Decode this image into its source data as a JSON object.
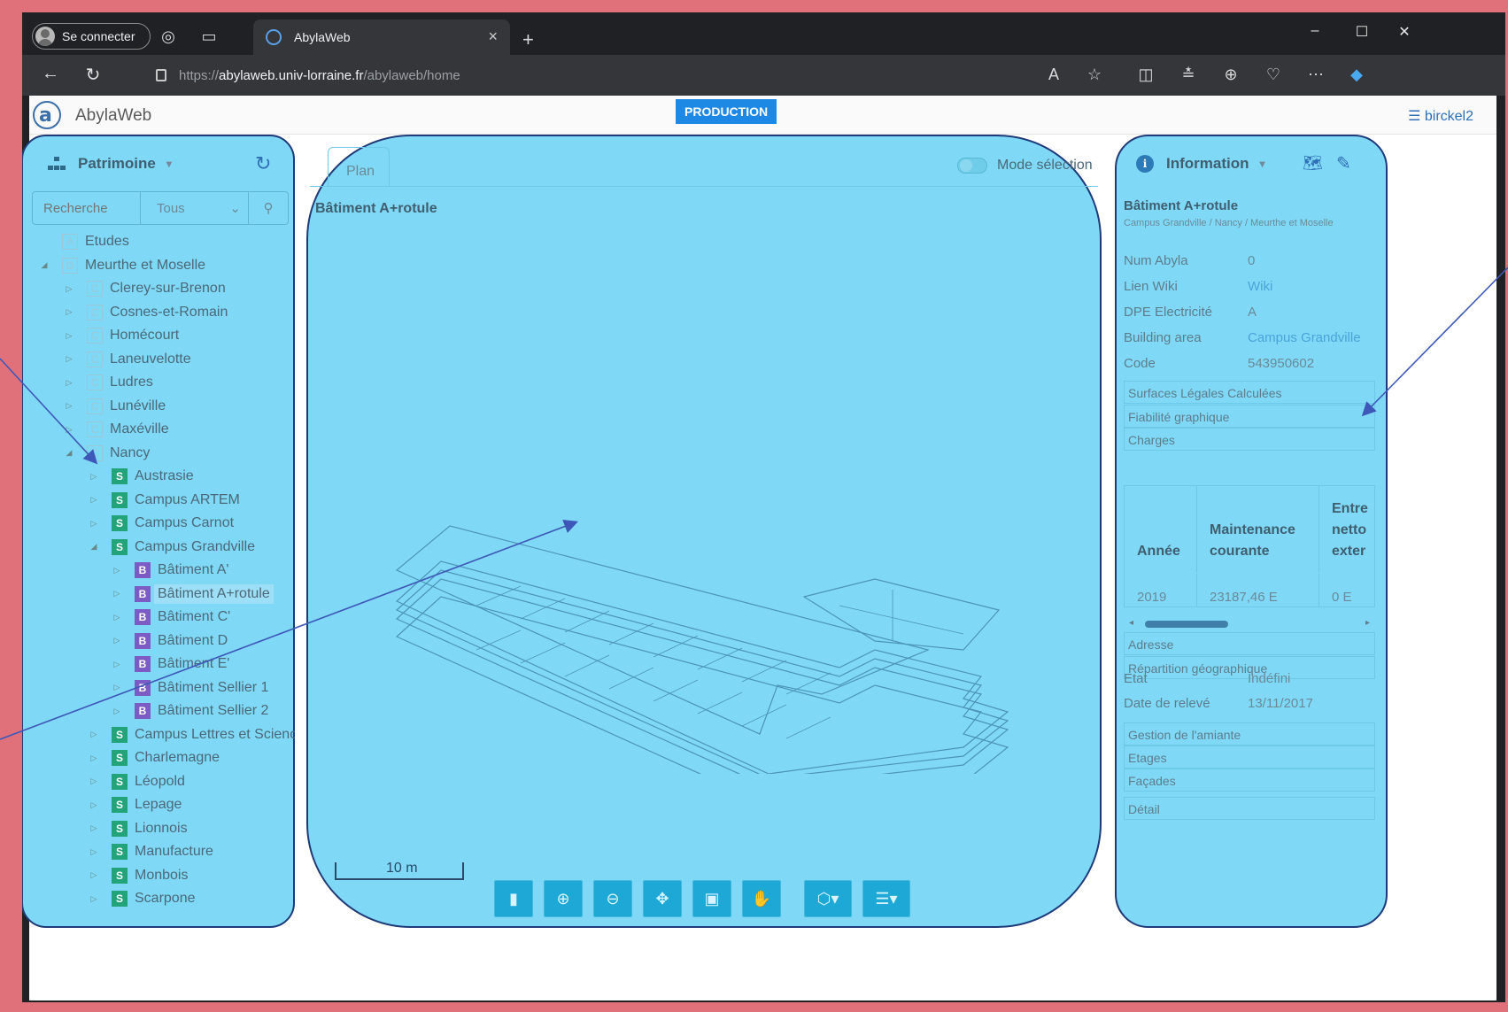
{
  "browser": {
    "profile_label": "Se connecter",
    "tab_title": "AbylaWeb",
    "url_scheme": "https://",
    "url_host": "abylaweb.univ-lorraine.fr",
    "url_path": "/abylaweb/home",
    "new_tab": "+",
    "tab_close": "×",
    "win_min": "–",
    "win_max": "☐",
    "win_close": "✕"
  },
  "app": {
    "title": "AbylaWeb",
    "env_badge": "PRODUCTION",
    "user": "☰ birckel2"
  },
  "left_panel": {
    "title": "Patrimoine",
    "search_placeholder": "Recherche",
    "filter_value": "Tous",
    "tree": [
      {
        "label": "Etudes",
        "badge": "A",
        "type": "outline",
        "level": 1,
        "expander": ""
      },
      {
        "label": "Meurthe et Moselle",
        "badge": "D",
        "type": "outline",
        "level": 1,
        "expander": "◢"
      },
      {
        "label": "Clerey-sur-Brenon",
        "badge": "C",
        "type": "outline",
        "level": 2,
        "expander": "▷"
      },
      {
        "label": "Cosnes-et-Romain",
        "badge": "C",
        "type": "outline",
        "level": 2,
        "expander": "▷"
      },
      {
        "label": "Homécourt",
        "badge": "C",
        "type": "outline",
        "level": 2,
        "expander": "▷"
      },
      {
        "label": "Laneuvelotte",
        "badge": "C",
        "type": "outline",
        "level": 2,
        "expander": "▷"
      },
      {
        "label": "Ludres",
        "badge": "C",
        "type": "outline",
        "level": 2,
        "expander": "▷"
      },
      {
        "label": "Lunéville",
        "badge": "C",
        "type": "outline",
        "level": 2,
        "expander": "▷"
      },
      {
        "label": "Maxéville",
        "badge": "C",
        "type": "outline",
        "level": 2,
        "expander": "▷"
      },
      {
        "label": "Nancy",
        "badge": "C",
        "type": "outline",
        "level": 2,
        "expander": "◢"
      },
      {
        "label": "Austrasie",
        "badge": "S",
        "type": "site",
        "level": 3,
        "expander": "▷"
      },
      {
        "label": "Campus ARTEM",
        "badge": "S",
        "type": "site",
        "level": 3,
        "expander": "▷"
      },
      {
        "label": "Campus Carnot",
        "badge": "S",
        "type": "site",
        "level": 3,
        "expander": "▷"
      },
      {
        "label": "Campus Grandville",
        "badge": "S",
        "type": "site",
        "level": 3,
        "expander": "◢"
      },
      {
        "label": "Bâtiment A'",
        "badge": "B",
        "type": "bat",
        "level": 4,
        "expander": "▷"
      },
      {
        "label": "Bâtiment A+rotule",
        "badge": "B",
        "type": "bat",
        "level": 4,
        "expander": "▷",
        "selected": true
      },
      {
        "label": "Bâtiment C'",
        "badge": "B",
        "type": "bat",
        "level": 4,
        "expander": "▷"
      },
      {
        "label": "Bâtiment D",
        "badge": "B",
        "type": "bat",
        "level": 4,
        "expander": "▷"
      },
      {
        "label": "Bâtiment E'",
        "badge": "B",
        "type": "bat",
        "level": 4,
        "expander": "▷"
      },
      {
        "label": "Bâtiment Sellier 1",
        "badge": "B",
        "type": "bat",
        "level": 4,
        "expander": "▷"
      },
      {
        "label": "Bâtiment Sellier 2",
        "badge": "B",
        "type": "bat",
        "level": 4,
        "expander": "▷"
      },
      {
        "label": "Campus Lettres et Sciences",
        "badge": "S",
        "type": "site",
        "level": 3,
        "expander": "▷"
      },
      {
        "label": "Charlemagne",
        "badge": "S",
        "type": "site",
        "level": 3,
        "expander": "▷"
      },
      {
        "label": "Léopold",
        "badge": "S",
        "type": "site",
        "level": 3,
        "expander": "▷"
      },
      {
        "label": "Lepage",
        "badge": "S",
        "type": "site",
        "level": 3,
        "expander": "▷"
      },
      {
        "label": "Lionnois",
        "badge": "S",
        "type": "site",
        "level": 3,
        "expander": "▷"
      },
      {
        "label": "Manufacture",
        "badge": "S",
        "type": "site",
        "level": 3,
        "expander": "▷"
      },
      {
        "label": "Monbois",
        "badge": "S",
        "type": "site",
        "level": 3,
        "expander": "▷"
      },
      {
        "label": "Scarpone",
        "badge": "S",
        "type": "site",
        "level": 3,
        "expander": "▷"
      }
    ]
  },
  "center": {
    "tab_label": "Plan",
    "mode_label": "Mode sélection",
    "building_title": "Bâtiment A+rotule",
    "scale_label": "10 m"
  },
  "right_panel": {
    "title": "Information",
    "building": "Bâtiment A+rotule",
    "path": "Campus Grandville / Nancy / Meurthe et Moselle",
    "fields": [
      {
        "k": "Num Abyla",
        "v": "0"
      },
      {
        "k": "Lien Wiki",
        "v": "Wiki",
        "link": true
      },
      {
        "k": "DPE Electricité",
        "v": "A"
      },
      {
        "k": "Building area",
        "v": "Campus Grandville",
        "link": true
      },
      {
        "k": "Code",
        "v": "543950602"
      }
    ],
    "sections_top": [
      "Surfaces Légales Calculées",
      "Fiabilité graphique",
      "Charges"
    ],
    "charges": {
      "headers": [
        "Année",
        "Maintenance courante",
        "Entre netto exter"
      ],
      "row": [
        "2019",
        "23187,46 E",
        "0 E"
      ]
    },
    "sections_mid": [
      "Adresse",
      "Répartition géographique"
    ],
    "fields2": [
      {
        "k": "Etat",
        "v": "Indéfini"
      },
      {
        "k": "Date de relevé",
        "v": "13/11/2017"
      }
    ],
    "sections_bottom": [
      "Gestion de l'amiante",
      "Etages",
      "Façades",
      "Détail"
    ]
  }
}
